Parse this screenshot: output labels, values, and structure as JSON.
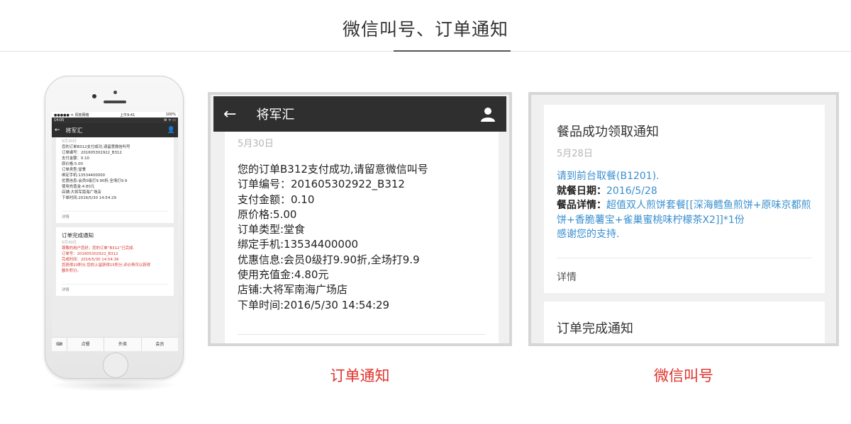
{
  "header": {
    "title": "微信叫号、订单通知"
  },
  "phone": {
    "status_bar": {
      "carrier": "●●●●● ᯤ 风软网络",
      "time": "上午9:41",
      "battery": "100%"
    },
    "status_bar2": {
      "time": "14:05",
      "icons": "⚙ ᯤ ▭"
    },
    "chat": {
      "title": "将军汇"
    },
    "card1": {
      "date": "5月30日",
      "lines": [
        "您的订单B312支付成功,请留意微信叫号",
        "订单编号：201605302922_B312",
        "支付金额：0.10",
        "原价格:5.00",
        "订单类型:堂食",
        "绑定手机:13534400000",
        "优惠信息:会员0级打9.90折,全场打9.9",
        "使用充值金:4.80元",
        "店铺:大将军南海广场店",
        "下单时间:2016/5/30 14:54:29"
      ],
      "detail": "详情"
    },
    "card2": {
      "title": "订单完成通知",
      "date": "5月30日",
      "lines": [
        "尊敬的用户您好，您的订单“B312”已完成.",
        "订单号：201605302922_B312",
        "完成时间：2016/5/30 14:54:36",
        "您获得20积分,您的上留获得15积分,评价再可以获得",
        "额外积分。"
      ],
      "detail": "详情"
    },
    "tabbar": {
      "keyboard": "⌨",
      "tabs": [
        "点餐",
        "外卖",
        "会员"
      ]
    }
  },
  "panel_order": {
    "bar_title": "将军汇",
    "date": "5月30日",
    "lines": [
      "您的订单B312支付成功,请留意微信叫号",
      "订单编号：201605302922_B312",
      "支付金额：0.10",
      "原价格:5.00",
      "订单类型:堂食",
      "绑定手机:13534400000",
      "优惠信息:会员0级打9.90折,全场打9.9",
      "使用充值金:4.80元",
      "店铺:大将军南海广场店",
      "下单时间:2016/5/30 14:54:29"
    ],
    "caption": "订单通知"
  },
  "panel_call": {
    "card_title": "餐品成功领取通知",
    "date": "5月28日",
    "line1": "请到前台取餐(B1201).",
    "line2_label": "就餐日期：",
    "line2_value": "2016/5/28",
    "line3_label": "餐品详情：",
    "line3_value": "超值双人煎饼套餐[[深海鳕鱼煎饼+原味京都煎饼+香脆薯宝+雀巢蜜桃味柠檬茶X2]]*1份",
    "line4": "感谢您的支持.",
    "detail": "详情",
    "card2_title": "订单完成通知",
    "caption": "微信叫号"
  },
  "colors": {
    "accent_red": "#e0322b",
    "link_blue": "#3a8fcf",
    "bar_dark": "#2f2f2f"
  }
}
